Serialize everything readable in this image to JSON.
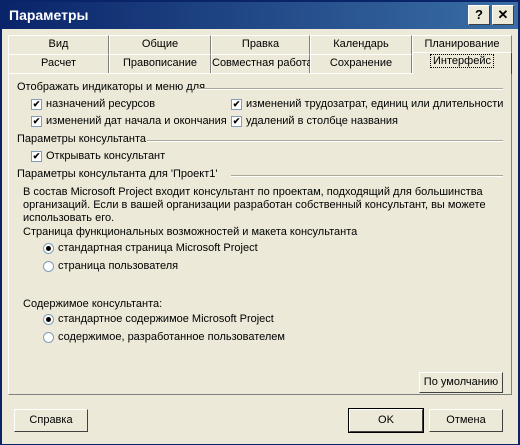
{
  "window": {
    "title": "Параметры",
    "help_glyph": "?",
    "close_glyph": "✕"
  },
  "tabs_row1": [
    "Вид",
    "Общие",
    "Правка",
    "Календарь",
    "Планирование"
  ],
  "tabs_row2": [
    "Расчет",
    "Правописание",
    "Совместная работа",
    "Сохранение",
    "Интерфейс"
  ],
  "section_indicators": {
    "label": "Отображать индикаторы и меню для",
    "items": [
      {
        "label": "назначений ресурсов",
        "checked": true
      },
      {
        "label": "изменений трудозатрат, единиц или длительности",
        "checked": true
      },
      {
        "label": "изменений дат начала и окончания",
        "checked": true
      },
      {
        "label": "удалений в столбце названия",
        "checked": true
      }
    ]
  },
  "section_advisor": {
    "label": "Параметры консультанта",
    "items": [
      {
        "label": "Открывать консультант",
        "checked": true
      }
    ]
  },
  "section_project": {
    "label": "Параметры консультанта для 'Проект1'",
    "description": "В состав Microsoft Project входит консультант по проектам, подходящий для большинства организаций. Если в вашей организации разработан собственный консультант, вы можете использовать его.",
    "page_label": "Страница функциональных возможностей и макета консультанта",
    "page_options": [
      {
        "label": "стандартная страница Microsoft Project",
        "selected": true
      },
      {
        "label": "страница пользователя",
        "selected": false
      }
    ],
    "content_label": "Содержимое консультанта:",
    "content_options": [
      {
        "label": "стандартное содержимое Microsoft Project",
        "selected": true
      },
      {
        "label": "содержимое, разработанное пользователем",
        "selected": false
      }
    ]
  },
  "buttons": {
    "default": "По умолчанию",
    "help": "Справка",
    "ok": "OK",
    "cancel": "Отмена"
  },
  "check_glyph": "✔"
}
